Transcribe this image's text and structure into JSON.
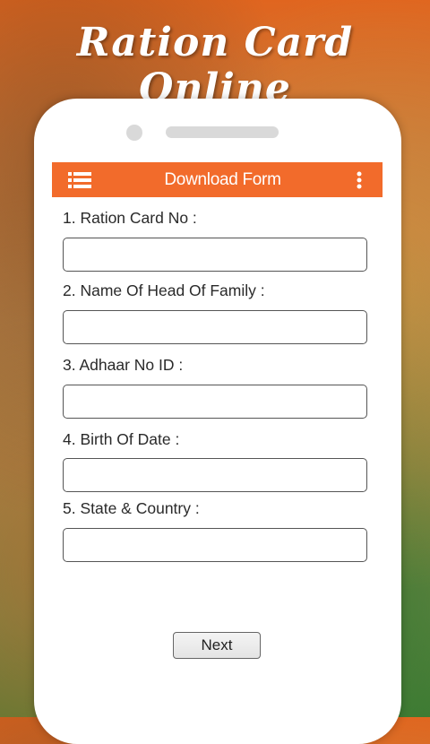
{
  "banner": {
    "title": "Ration Card Online"
  },
  "appbar": {
    "title": "Download Form",
    "menu_icon": "hamburger-menu-icon",
    "more_icon": "more-vertical-icon",
    "color": "#f26b2b"
  },
  "form": {
    "fields": [
      {
        "label": "1. Ration Card No :",
        "value": ""
      },
      {
        "label": "2. Name Of Head Of Family :",
        "value": ""
      },
      {
        "label": "3. Adhaar No ID :",
        "value": ""
      },
      {
        "label": "4. Birth Of Date :",
        "value": ""
      },
      {
        "label": "5. State & Country :",
        "value": ""
      }
    ],
    "next_label": "Next"
  }
}
